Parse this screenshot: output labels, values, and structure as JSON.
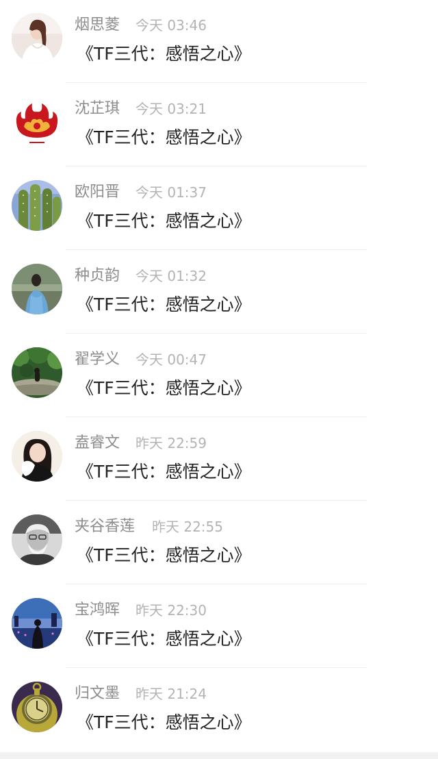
{
  "comments": [
    {
      "name": "烟思菱",
      "time": "今天 03:46",
      "message": "《TF三代：感悟之心》",
      "avatar": "avatar-woman-white-dress"
    },
    {
      "name": "沈芷琪",
      "time": "今天 03:21",
      "message": "《TF三代：感悟之心》",
      "avatar": "avatar-red-fire-emblem"
    },
    {
      "name": "欧阳晋",
      "time": "今天 01:37",
      "message": "《TF三代：感悟之心》",
      "avatar": "avatar-cactus"
    },
    {
      "name": "种贞韵",
      "time": "今天 01:32",
      "message": "《TF三代：感悟之心》",
      "avatar": "avatar-girl-blue-jacket"
    },
    {
      "name": "翟学义",
      "time": "今天 00:47",
      "message": "《TF三代：感悟之心》",
      "avatar": "avatar-forest-rock"
    },
    {
      "name": "盍睿文",
      "time": "昨天 22:59",
      "message": "《TF三代：感悟之心》",
      "avatar": "avatar-girl-white-towel"
    },
    {
      "name": "夹谷香莲",
      "time": "昨天 22:55",
      "message": "《TF三代：感悟之心》",
      "avatar": "avatar-old-man-bw"
    },
    {
      "name": "宝鸿晖",
      "time": "昨天 22:30",
      "message": "《TF三代：感悟之心》",
      "avatar": "avatar-girl-night-city"
    },
    {
      "name": "归文墨",
      "time": "昨天 21:24",
      "message": "《TF三代：感悟之心》",
      "avatar": "avatar-pocket-watch"
    }
  ]
}
